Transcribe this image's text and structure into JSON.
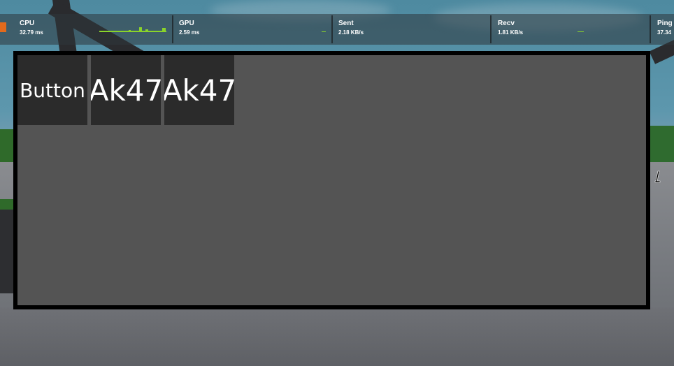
{
  "stats": {
    "cpu": {
      "label": "CPU",
      "value": "32.79 ms"
    },
    "gpu": {
      "label": "GPU",
      "value": "2.59 ms"
    },
    "sent": {
      "label": "Sent",
      "value": "2.18 KB/s"
    },
    "recv": {
      "label": "Recv",
      "value": "1.81 KB/s"
    },
    "ping": {
      "label": "Ping",
      "value": "37.34"
    },
    "graph_color": "#8ad42a",
    "indicator_color": "#e26a1c"
  },
  "inventory": {
    "slots": [
      {
        "label": "Button"
      },
      {
        "label": "Ak47"
      },
      {
        "label": "Ak47"
      }
    ]
  },
  "cursor": {
    "icon": "text-cursor-icon"
  }
}
